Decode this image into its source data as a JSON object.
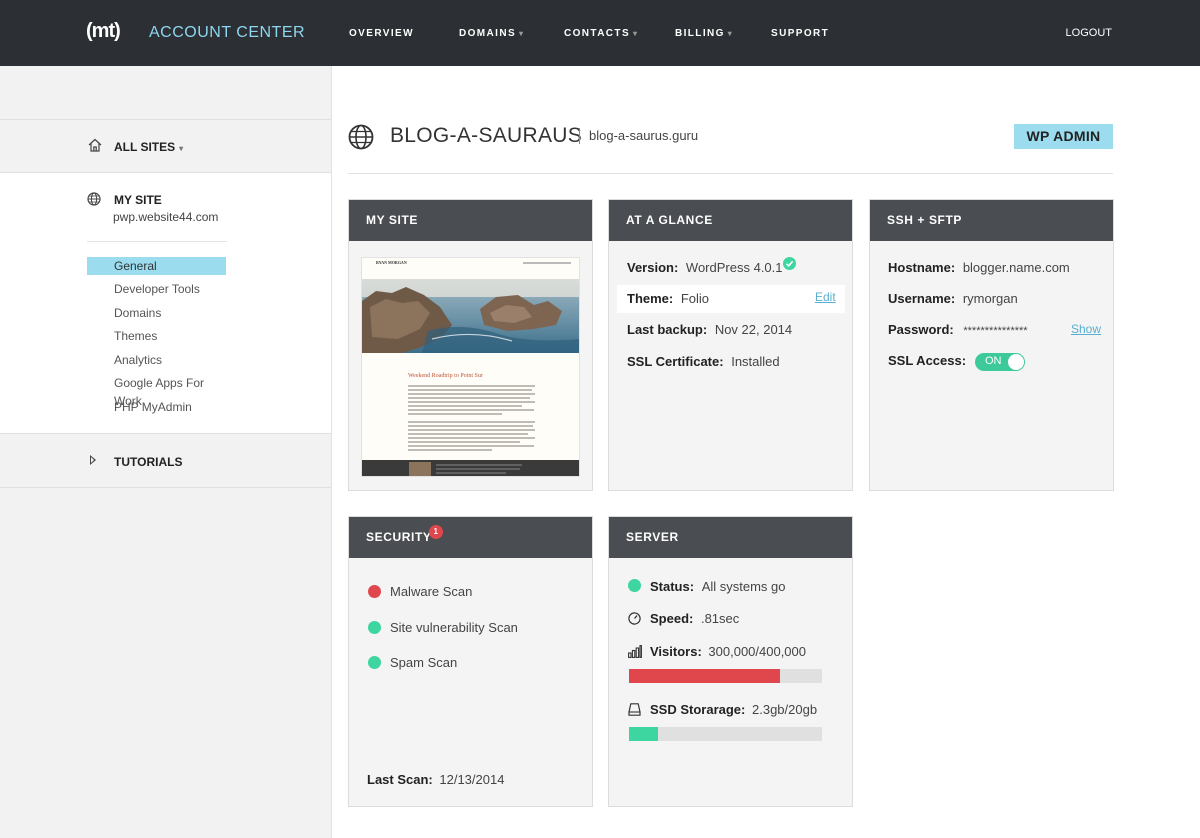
{
  "header": {
    "logo": "(mt)",
    "app_title": "ACCOUNT CENTER",
    "nav": [
      "OVERVIEW",
      "DOMAINS",
      "CONTACTS",
      "BILLING",
      "SUPPORT"
    ],
    "logout": "LOGOUT"
  },
  "sidebar": {
    "all_sites": "ALL SITES",
    "my_site_title": "MY SITE",
    "my_site_url": "pwp.website44.com",
    "items": [
      "General",
      "Developer Tools",
      "Domains",
      "Themes",
      "Analytics",
      "Google Apps For Work",
      "PHP MyAdmin"
    ],
    "active_item": "General",
    "tutorials": "TUTORIALS"
  },
  "site": {
    "name": "BLOG-A-SAURAUS",
    "domain": "blog-a-saurus.guru",
    "wp_admin": "WP ADMIN"
  },
  "my_site_card": {
    "title": "MY SITE",
    "preview": {
      "author": "RYAN MORGAN",
      "post_title": "Weekend Roadtrip to Point Sur"
    }
  },
  "glance": {
    "title": "AT A GLANCE",
    "version_label": "Version:",
    "version_value": "WordPress 4.0.1",
    "theme_label": "Theme:",
    "theme_value": "Folio",
    "theme_edit": "Edit",
    "backup_label": "Last backup:",
    "backup_value": "Nov 22, 2014",
    "ssl_label": "SSL Certificate:",
    "ssl_value": "Installed"
  },
  "ssh": {
    "title": "SSH + SFTP",
    "hostname_label": "Hostname:",
    "hostname_value": "blogger.name.com",
    "username_label": "Username:",
    "username_value": "rymorgan",
    "password_label": "Password:",
    "password_value": "***************",
    "password_show": "Show",
    "ssl_access_label": "SSL Access:",
    "ssl_access_value": "ON"
  },
  "security": {
    "title": "SECURITY",
    "badge": "1",
    "scans": [
      {
        "label": "Malware Scan",
        "status_color": "#e0474c"
      },
      {
        "label": "Site vulnerability Scan",
        "status_color": "#3ed6a0"
      },
      {
        "label": "Spam Scan",
        "status_color": "#3ed6a0"
      }
    ],
    "last_scan_label": "Last Scan:",
    "last_scan_value": "12/13/2014"
  },
  "server": {
    "title": "SERVER",
    "status_label": "Status:",
    "status_value": "All systems go",
    "speed_label": "Speed:",
    "speed_value": ".81sec",
    "visitors_label": "Visitors:",
    "visitors_value": "300,000/400,000",
    "visitors_fraction": 0.78,
    "storage_label": "SSD Storarage:",
    "storage_value": "2.3gb/20gb",
    "storage_fraction": 0.15,
    "colors": {
      "ok": "#3ed6a0",
      "alert": "#e0474c"
    }
  }
}
